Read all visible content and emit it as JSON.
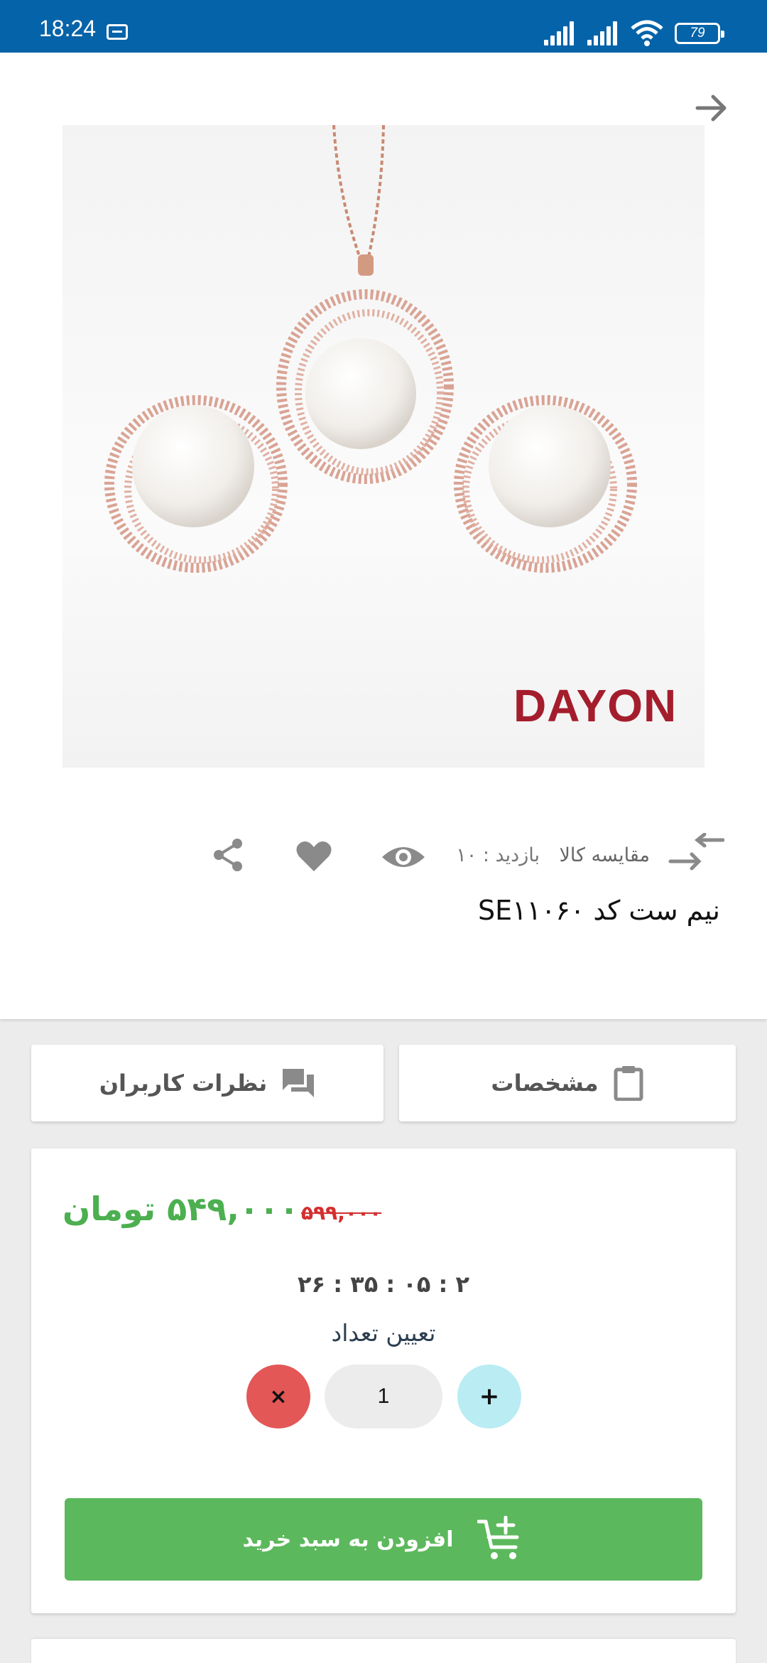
{
  "status_bar": {
    "time": "18:24",
    "battery": "79"
  },
  "product": {
    "brand_logo_text": "DAYON",
    "title": "نیم ست کد SE۱۱۰۶۰",
    "compare_label": "مقایسه کالا",
    "views_label": "بازدید : ۱۰"
  },
  "tabs": {
    "specs": "مشخصات",
    "reviews": "نظرات کاربران"
  },
  "price": {
    "new": "۵۴۹,۰۰۰ تومان",
    "old": "۵۹۹,۰۰۰",
    "countdown": "۲۶ : ۳۵ : ۰۵ : ۲",
    "quantity_label": "تعیین تعداد",
    "quantity": "1",
    "remove_symbol": "×",
    "add_symbol": "+",
    "add_to_cart": "افزودن به سبد خرید"
  },
  "colors": {
    "status_bar": "#0563a9",
    "price_green": "#4caf50",
    "old_price_red": "#d32f2f",
    "cart_green": "#5cb85c"
  }
}
